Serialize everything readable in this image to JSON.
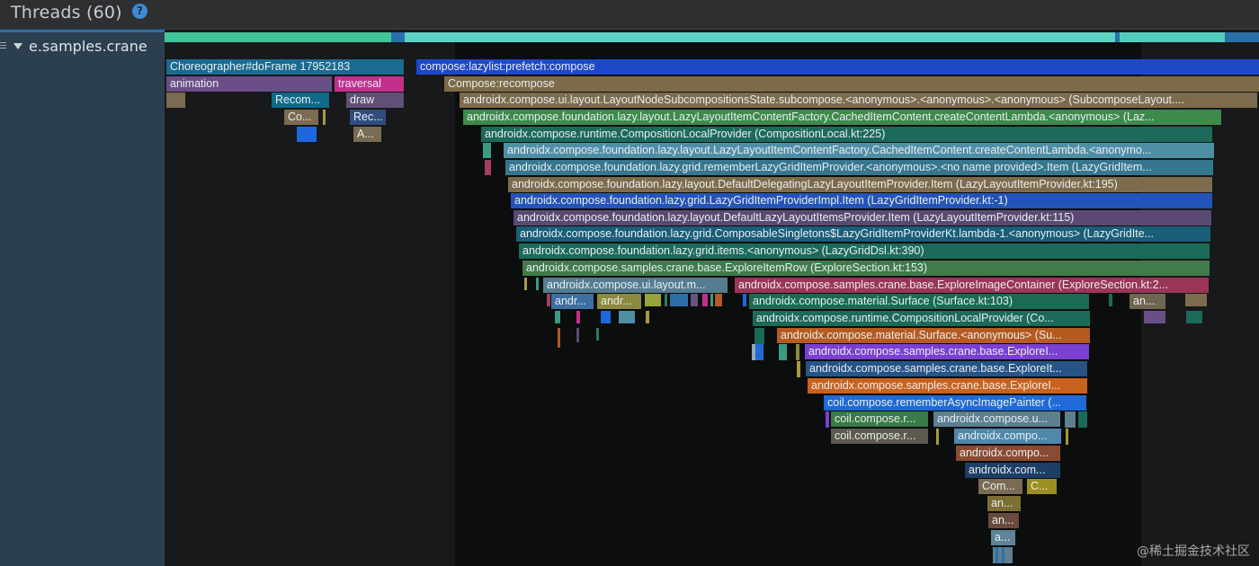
{
  "header": {
    "title": "Threads (60)",
    "help_glyph": "?"
  },
  "thread": {
    "name": "e.samples.crane"
  },
  "watermark": "@稀土掘金技术社区",
  "strip": [
    {
      "color": "#43c49a"
    },
    {
      "color": "#2a6fa8"
    },
    {
      "color": "#5fd1c4"
    },
    {
      "color": "#2a6fa8"
    },
    {
      "color": "#55cbbd"
    },
    {
      "color": "#2a6fa8"
    }
  ],
  "slices": [
    {
      "label": "Choreographer#doFrame 17952183",
      "color": "#1b6a8f"
    },
    {
      "label": "compose:lazylist:prefetch:compose",
      "color": "#1f48c9"
    },
    {
      "label": "animation",
      "color": "#6a4f86"
    },
    {
      "label": "traversal",
      "color": "#c2308c"
    },
    {
      "label": "Compose:recompose",
      "color": "#7c6a48"
    },
    {
      "label": "",
      "color": "#7a6b52"
    },
    {
      "label": "Recom...",
      "color": "#106a89"
    },
    {
      "label": "draw",
      "color": "#605078"
    },
    {
      "label": "androidx.compose.ui.layout.LayoutNodeSubcompositionsState.subcompose.<anonymous>.<anonymous>.<anonymous> (SubcomposeLayout....",
      "color": "#7d6c4c"
    },
    {
      "label": "Co...",
      "color": "#7a6b52"
    },
    {
      "label": "",
      "color": "#a99a3c"
    },
    {
      "label": "Rec...",
      "color": "#314d80"
    },
    {
      "label": "androidx.compose.foundation.lazy.layout.LazyLayoutItemContentFactory.CachedItemContent.createContentLambda.<anonymous> (Laz...",
      "color": "#3e8a4a"
    },
    {
      "label": "",
      "color": "#1f67dc"
    },
    {
      "label": "A...",
      "color": "#7a6b52"
    },
    {
      "label": "androidx.compose.runtime.CompositionLocalProvider (CompositionLocal.kt:225)",
      "color": "#1c6b5a"
    },
    {
      "label": "",
      "color": "#3b9b82"
    },
    {
      "label": "androidx.compose.foundation.lazy.layout.LazyLayoutItemContentFactory.CachedItemContent.createContentLambda.<anonymo...",
      "color": "#4f8fa6"
    },
    {
      "label": "",
      "color": "#a83d5f"
    },
    {
      "label": "androidx.compose.foundation.lazy.grid.rememberLazyGridItemProvider.<anonymous>.<no name provided>.Item (LazyGridItem...",
      "color": "#37768f"
    },
    {
      "label": "androidx.compose.foundation.lazy.layout.DefaultDelegatingLazyLayoutItemProvider.Item (LazyLayoutItemProvider.kt:195)",
      "color": "#7d6c4c"
    },
    {
      "label": "androidx.compose.foundation.lazy.grid.LazyGridItemProviderImpl.Item (LazyGridItemProvider.kt:-1)",
      "color": "#2454b8"
    },
    {
      "label": "androidx.compose.foundation.lazy.layout.DefaultLazyLayoutItemsProvider.Item (LazyLayoutItemProvider.kt:115)",
      "color": "#5a4a73"
    },
    {
      "label": "androidx.compose.foundation.lazy.grid.ComposableSingletons$LazyGridItemProviderKt.lambda-1.<anonymous> (LazyGridIte...",
      "color": "#1a5e78"
    },
    {
      "label": "androidx.compose.foundation.lazy.grid.items.<anonymous> (LazyGridDsl.kt:390)",
      "color": "#1c6b5a"
    },
    {
      "label": "androidx.compose.samples.crane.base.ExploreItemRow (ExploreSection.kt:153)",
      "color": "#3f7b4b"
    },
    {
      "label": "androidx.compose.ui.layout.m...",
      "color": "#557d91"
    },
    {
      "label": "androidx.compose.samples.crane.base.ExploreImageContainer (ExploreSection.kt:2...",
      "color": "#9b3558"
    },
    {
      "label": "andr...",
      "color": "#3f6fa1"
    },
    {
      "label": "andr...",
      "color": "#8c8a3c"
    },
    {
      "label": "androidx.compose.material.Surface (Surface.kt:103)",
      "color": "#196b56"
    },
    {
      "label": "an...",
      "color": "#6f6650"
    },
    {
      "label": "androidx.compose.runtime.CompositionLocalProvider (Co...",
      "color": "#1c6b5a"
    },
    {
      "label": "androidx.compose.material.Surface.<anonymous> (Su...",
      "color": "#b55a21"
    },
    {
      "label": "androidx.compose.samples.crane.base.ExploreI...",
      "color": "#7b3fd2"
    },
    {
      "label": "androidx.compose.samples.crane.base.ExploreIt...",
      "color": "#265487"
    },
    {
      "label": "androidx.compose.samples.crane.base.ExploreI...",
      "color": "#c9621e"
    },
    {
      "label": "coil.compose.rememberAsyncImagePainter (...",
      "color": "#1f6ad7"
    },
    {
      "label": "coil.compose.r...",
      "color": "#3a7a46"
    },
    {
      "label": "androidx.compose.u...",
      "color": "#5d7f90"
    },
    {
      "label": "coil.compose.r...",
      "color": "#5d5a4e"
    },
    {
      "label": "androidx.compo...",
      "color": "#4f88ab"
    },
    {
      "label": "androidx.compo...",
      "color": "#8b4b32"
    },
    {
      "label": "androidx.com...",
      "color": "#1d3f66"
    },
    {
      "label": "Com...",
      "color": "#7a6b52"
    },
    {
      "label": "C...",
      "color": "#9c8f21"
    },
    {
      "label": "an...",
      "color": "#7c6f34"
    },
    {
      "label": "an...",
      "color": "#6a4a3e"
    },
    {
      "label": "a...",
      "color": "#5f8399"
    }
  ],
  "blocks": [
    {
      "color": "#1f67dc"
    },
    {
      "color": "#a99a3c"
    },
    {
      "color": "#3b9b82"
    },
    {
      "color": "#a83d5f"
    },
    {
      "color": "#9aa23c"
    },
    {
      "color": "#2f7b58"
    },
    {
      "color": "#4f8fa6"
    },
    {
      "color": "#7b3fd2"
    },
    {
      "color": "#2a6fa8"
    },
    {
      "color": "#b55a21"
    },
    {
      "color": "#6a4f86"
    },
    {
      "color": "#9aa6b0"
    },
    {
      "color": "#c2308c"
    },
    {
      "color": "#196b56"
    },
    {
      "color": "#c9621e"
    },
    {
      "color": "#1f48c9"
    },
    {
      "color": "#8c8a3c"
    },
    {
      "color": "#37768f"
    },
    {
      "color": "#5a4a73"
    },
    {
      "color": "#3f7b4b"
    },
    {
      "color": "#1f6ad7"
    },
    {
      "color": "#9b3558"
    },
    {
      "color": "#7d6c4c"
    },
    {
      "color": "#6f6650"
    },
    {
      "color": "#5d7f90"
    },
    {
      "color": "#a59a2a"
    },
    {
      "color": "#1c6b5a"
    }
  ]
}
